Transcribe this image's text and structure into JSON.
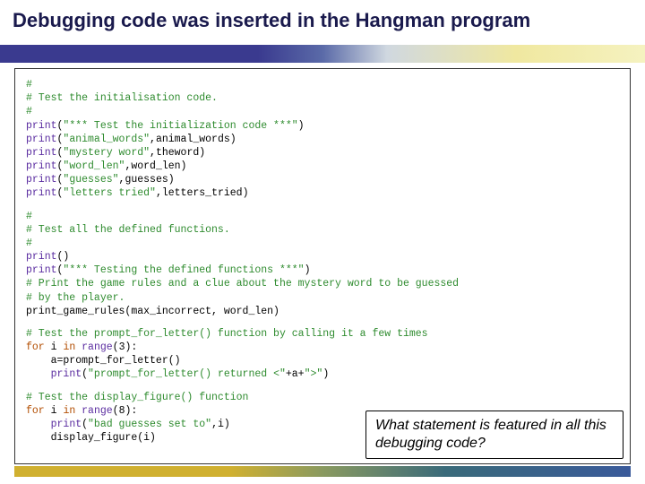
{
  "title": "Debugging code was inserted in the Hangman program",
  "code": {
    "block1": {
      "c1": "#",
      "c2": "# Test the initialisation code.",
      "c3": "#",
      "l1a": "print",
      "l1b": "(",
      "l1c": "\"*** Test the initialization code ***\"",
      "l1d": ")",
      "l2a": "print",
      "l2b": "(",
      "l2c": "\"animal_words\"",
      "l2d": ",animal_words)",
      "l3a": "print",
      "l3b": "(",
      "l3c": "\"mystery word\"",
      "l3d": ",theword)",
      "l4a": "print",
      "l4b": "(",
      "l4c": "\"word_len\"",
      "l4d": ",word_len)",
      "l5a": "print",
      "l5b": "(",
      "l5c": "\"guesses\"",
      "l5d": ",guesses)",
      "l6a": "print",
      "l6b": "(",
      "l6c": "\"letters tried\"",
      "l6d": ",letters_tried)"
    },
    "block2": {
      "c1": "#",
      "c2": "# Test all the defined functions.",
      "c3": "#",
      "l1a": "print",
      "l1b": "()",
      "l2a": "print",
      "l2b": "(",
      "l2c": "\"*** Testing the defined functions ***\"",
      "l2d": ")",
      "c4": "# Print the game rules and a clue about the mystery word to be guessed",
      "c5": "# by the player.",
      "l3": "print_game_rules(max_incorrect, word_len)"
    },
    "block3": {
      "c1": "# Test the prompt_for_letter() function by calling it a few times",
      "l1a": "for",
      "l1b": " i ",
      "l1c": "in",
      "l1d": " ",
      "l1e": "range",
      "l1f": "(3):",
      "l2": "    a=prompt_for_letter()",
      "l3a": "    ",
      "l3b": "print",
      "l3c": "(",
      "l3d": "\"prompt_for_letter() returned <\"",
      "l3e": "+a+",
      "l3f": "\">\"",
      "l3g": ")"
    },
    "block4": {
      "c1": "# Test the display_figure() function",
      "l1a": "for",
      "l1b": " i ",
      "l1c": "in",
      "l1d": " ",
      "l1e": "range",
      "l1f": "(8):",
      "l2a": "    ",
      "l2b": "print",
      "l2c": "(",
      "l2d": "\"bad guesses set to\"",
      "l2e": ",i)",
      "l3": "    display_figure(i)"
    }
  },
  "callout": "What statement is featured in all this debugging code?"
}
